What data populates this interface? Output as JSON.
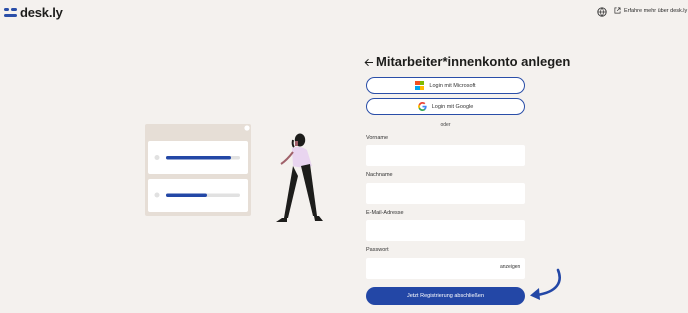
{
  "brand": {
    "name": "desk.ly",
    "accent": "#2347a6"
  },
  "header": {
    "ext_link_label": "Erfahre mehr über desk.ly",
    "ext_icon": "external-link-icon",
    "globe_icon": "globe-icon"
  },
  "form": {
    "title": "Mitarbeiter*innenkonto anlegen",
    "back_icon": "arrow-left-icon",
    "microsoft_label": "Login mit Microsoft",
    "google_label": "Login mit Google",
    "divider": "oder",
    "fields": {
      "first_name_label": "Vorname",
      "last_name_label": "Nachname",
      "email_label": "E-Mail-Adresse",
      "password_label": "Passwort",
      "show_password": "anzeigen"
    },
    "submit_label": "Jetzt Registrierung abschließen"
  }
}
